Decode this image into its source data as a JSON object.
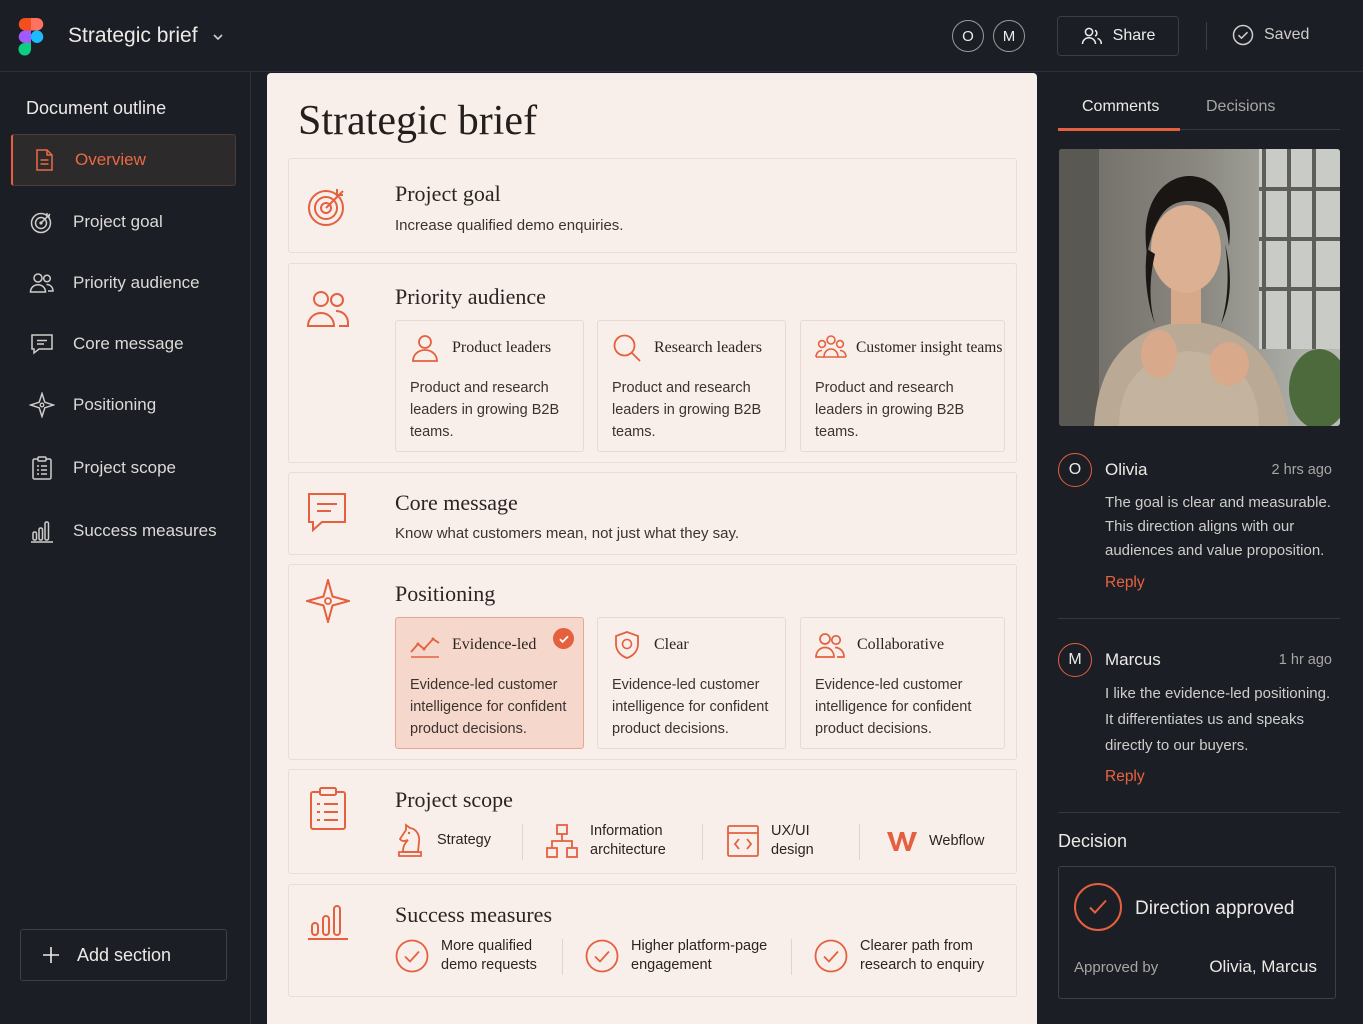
{
  "app": {
    "title": "Strategic brief"
  },
  "header": {
    "avatars": [
      "O",
      "M"
    ],
    "share_label": "Share",
    "saved_label": "Saved"
  },
  "sidebar": {
    "title": "Document outline",
    "items": [
      {
        "label": "Overview",
        "icon": "document-icon",
        "active": true
      },
      {
        "label": "Project goal",
        "icon": "target-icon"
      },
      {
        "label": "Priority audience",
        "icon": "users-icon"
      },
      {
        "label": "Core message",
        "icon": "message-icon"
      },
      {
        "label": "Positioning",
        "icon": "compass-star-icon"
      },
      {
        "label": "Project scope",
        "icon": "clipboard-icon"
      },
      {
        "label": "Success measures",
        "icon": "bar-chart-icon"
      }
    ],
    "add_section_label": "Add section"
  },
  "doc": {
    "title": "Strategic brief",
    "project_goal": {
      "title": "Project goal",
      "text": "Increase qualified demo enquiries."
    },
    "priority_audience": {
      "title": "Priority audience",
      "cards": [
        {
          "title": "Product leaders",
          "body": "Product and research leaders in growing B2B teams.",
          "icon": "person-icon"
        },
        {
          "title": "Research leaders",
          "body": "Product and research leaders in growing B2B teams.",
          "icon": "magnifier-icon"
        },
        {
          "title": "Customer insight teams",
          "body": "Product and research leaders in growing B2B teams.",
          "icon": "group-icon"
        }
      ]
    },
    "core_message": {
      "title": "Core message",
      "text": "Know what customers mean, not just what they say."
    },
    "positioning": {
      "title": "Positioning",
      "cards": [
        {
          "title": "Evidence-led",
          "body": "Evidence-led customer intelligence for confident product decisions.",
          "icon": "trend-line-icon",
          "selected": true
        },
        {
          "title": "Clear",
          "body": "Evidence-led customer intelligence for confident product decisions.",
          "icon": "shield-icon"
        },
        {
          "title": "Collaborative",
          "body": "Evidence-led customer intelligence for confident product decisions.",
          "icon": "people-icon"
        }
      ]
    },
    "project_scope": {
      "title": "Project scope",
      "items": [
        {
          "line1": "Strategy",
          "line2": "",
          "icon": "chess-knight-icon"
        },
        {
          "line1": "Information",
          "line2": "architecture",
          "icon": "sitemap-icon"
        },
        {
          "line1": "UX/UI",
          "line2": "design",
          "icon": "code-window-icon"
        },
        {
          "line1": "Webflow",
          "line2": "",
          "icon": "webflow-logo-icon"
        }
      ]
    },
    "success_measures": {
      "title": "Success measures",
      "items": [
        {
          "line1": "More qualified",
          "line2": "demo requests"
        },
        {
          "line1": "Higher platform-page",
          "line2": "engagement"
        },
        {
          "line1": "Clearer path from",
          "line2": "research to enquiry"
        }
      ]
    }
  },
  "panel": {
    "tabs": [
      "Comments",
      "Decisions"
    ],
    "active_tab": "Comments",
    "comments": [
      {
        "initial": "O",
        "name": "Olivia",
        "time": "2 hrs ago",
        "text": "The goal is clear and measurable. This direction aligns with our audiences and value proposition.",
        "reply": "Reply"
      },
      {
        "initial": "M",
        "name": "Marcus",
        "time": "1 hr ago",
        "text": "I like the evidence-led positioning. It differentiates us and speaks directly to our buyers.",
        "reply": "Reply"
      }
    ],
    "decision": {
      "title": "Decision",
      "status": "Direction approved",
      "approved_by_label": "Approved by",
      "approved_by": "Olivia, Marcus"
    }
  },
  "colors": {
    "accent": "#e5603f",
    "background": "#1b1e25",
    "document": "#f8efea"
  }
}
